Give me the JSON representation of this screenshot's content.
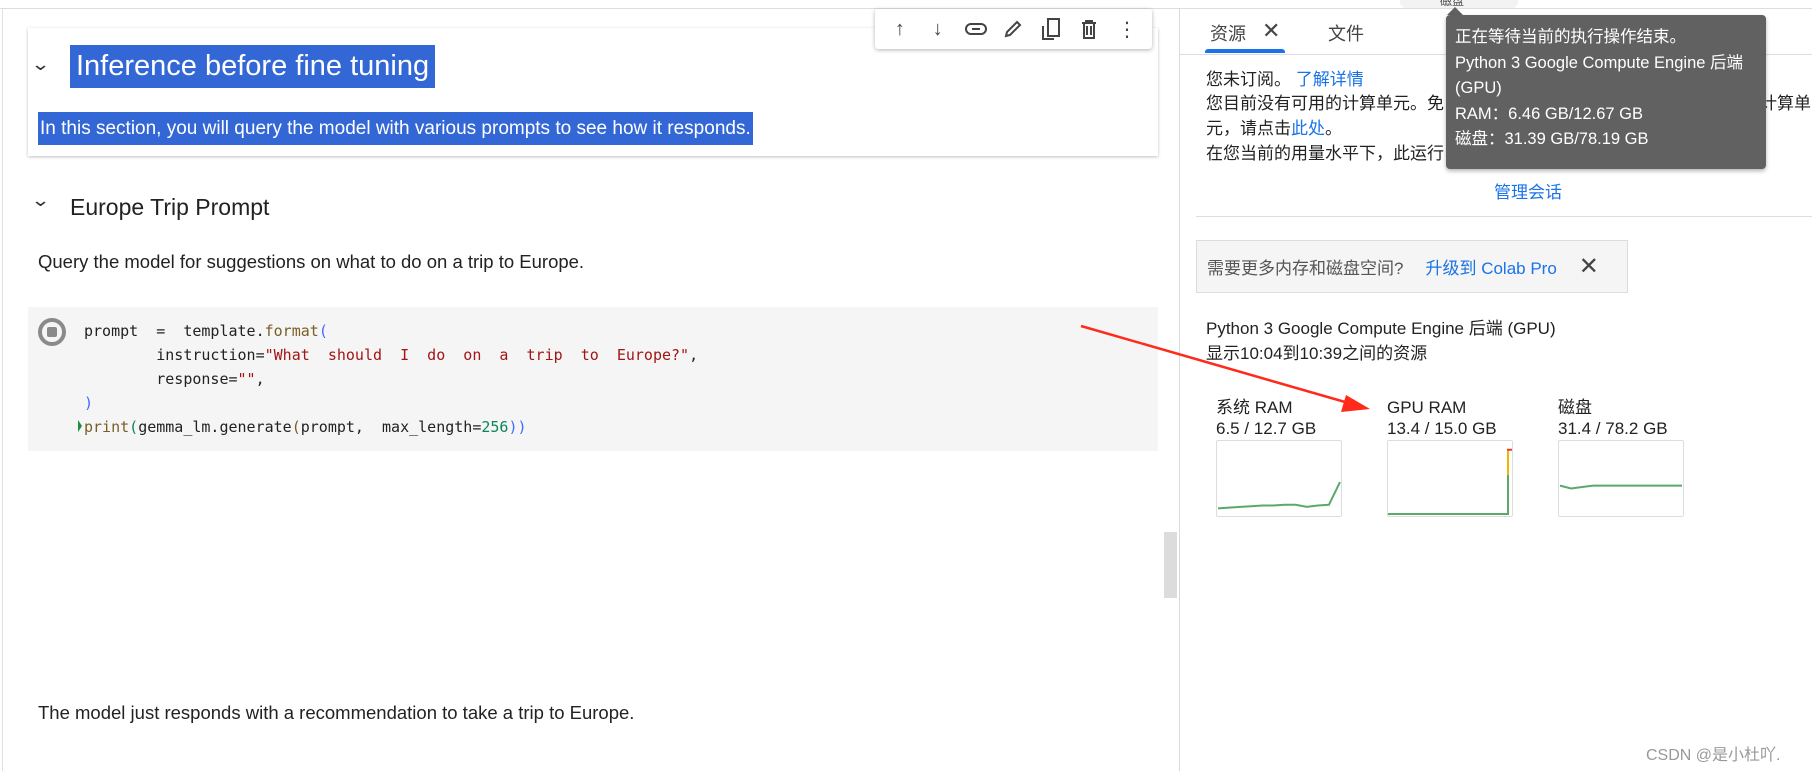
{
  "top_strip": {
    "label": "磁盘"
  },
  "notebook": {
    "section1": {
      "title": "Inference before fine tuning",
      "text": "In this section, you will query the model with various prompts to see how it responds."
    },
    "cell_toolbar": {
      "icons": [
        "arrow-up-icon",
        "arrow-down-icon",
        "link-icon",
        "pencil-icon",
        "mirror-cell-icon",
        "trash-icon",
        "more-vert-icon"
      ]
    },
    "section2": {
      "title": "Europe Trip Prompt",
      "text": "Query the model for suggestions on what to do on a trip to Europe."
    },
    "code": {
      "l1a": "prompt  =  template.",
      "l1b": "format",
      "l1c": "(",
      "l2a": "        instruction=",
      "l2b": "\"What  should  I  do  on  a  trip  to  Europe?\"",
      "l2c": ",",
      "l3a": "        response=",
      "l3b": "\"\"",
      "l3c": ",",
      "l4": ")",
      "l5a": "print",
      "l5b": "(",
      "l5c": "gemma_lm.generate",
      "l5d": "(",
      "l5e": "prompt,  max_length=",
      "l5f": "256",
      "l5g": "))"
    },
    "bottom_text": "The model just responds with a recommendation to take a trip to Europe."
  },
  "panel": {
    "tabs": [
      {
        "label": "资源"
      },
      {
        "label": "文件"
      }
    ],
    "subscription": {
      "not_subscribed": "您未订阅。",
      "learn_more": "了解详情",
      "line2_start": "您目前没有可用的计算单元。免",
      "line2_end": "计算单",
      "line3_start": "元，请点击",
      "line3_link": "此处",
      "line3_end": "。",
      "line4": "在您当前的用量水平下，此运行"
    },
    "manage_sessions": "管理会话",
    "upsell": {
      "text": "需要更多内存和磁盘空间?",
      "link": "升级到 Colab Pro"
    },
    "backend": "Python 3 Google Compute Engine 后端 (GPU)",
    "range": "显示10:04到10:39之间的资源",
    "charts": [
      {
        "label": "系统 RAM",
        "value": "6.5 / 12.7 GB",
        "series": [
          0.08,
          0.09,
          0.1,
          0.11,
          0.12,
          0.12,
          0.13,
          0.13,
          0.1,
          0.12,
          0.13,
          0.45
        ],
        "color": "#5aa86a"
      },
      {
        "label": "GPU RAM",
        "value": "13.4 / 15.0 GB",
        "series": [
          0,
          0,
          0,
          0,
          0,
          0,
          0,
          0,
          0,
          0,
          0,
          0.89
        ],
        "color": "#5aa86a",
        "warn_color": "#f4b400",
        "crit_color": "#e53935"
      },
      {
        "label": "磁盘",
        "value": "31.4 / 78.2 GB",
        "series": [
          0.4,
          0.36,
          0.38,
          0.4,
          0.4,
          0.4,
          0.4,
          0.4,
          0.4,
          0.4,
          0.4,
          0.4
        ],
        "color": "#5aa86a"
      }
    ]
  },
  "tooltip": {
    "line1": "正在等待当前的执行操作结束。",
    "line2": "Python 3 Google Compute Engine 后端",
    "line3": "(GPU)",
    "line4": "RAM：6.46 GB/12.67 GB",
    "line5": "磁盘：31.39 GB/78.19 GB"
  },
  "annotation": {
    "arrow_color": "#ff2a1a"
  },
  "watermark": "CSDN @是小杜吖."
}
